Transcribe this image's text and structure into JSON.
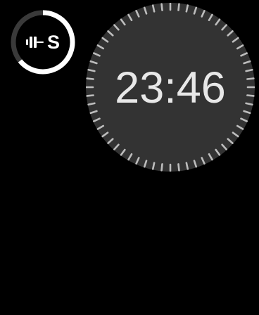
{
  "complication": {
    "icon": "dumbbell-icon",
    "label": "S",
    "progress": 0.64,
    "ring_color": "#ffffff",
    "track_color": "#3a3a3a"
  },
  "clock": {
    "time": "23:46",
    "face_color": "#333333",
    "tick_color": "#bdbdbd",
    "tick_count": 60
  }
}
